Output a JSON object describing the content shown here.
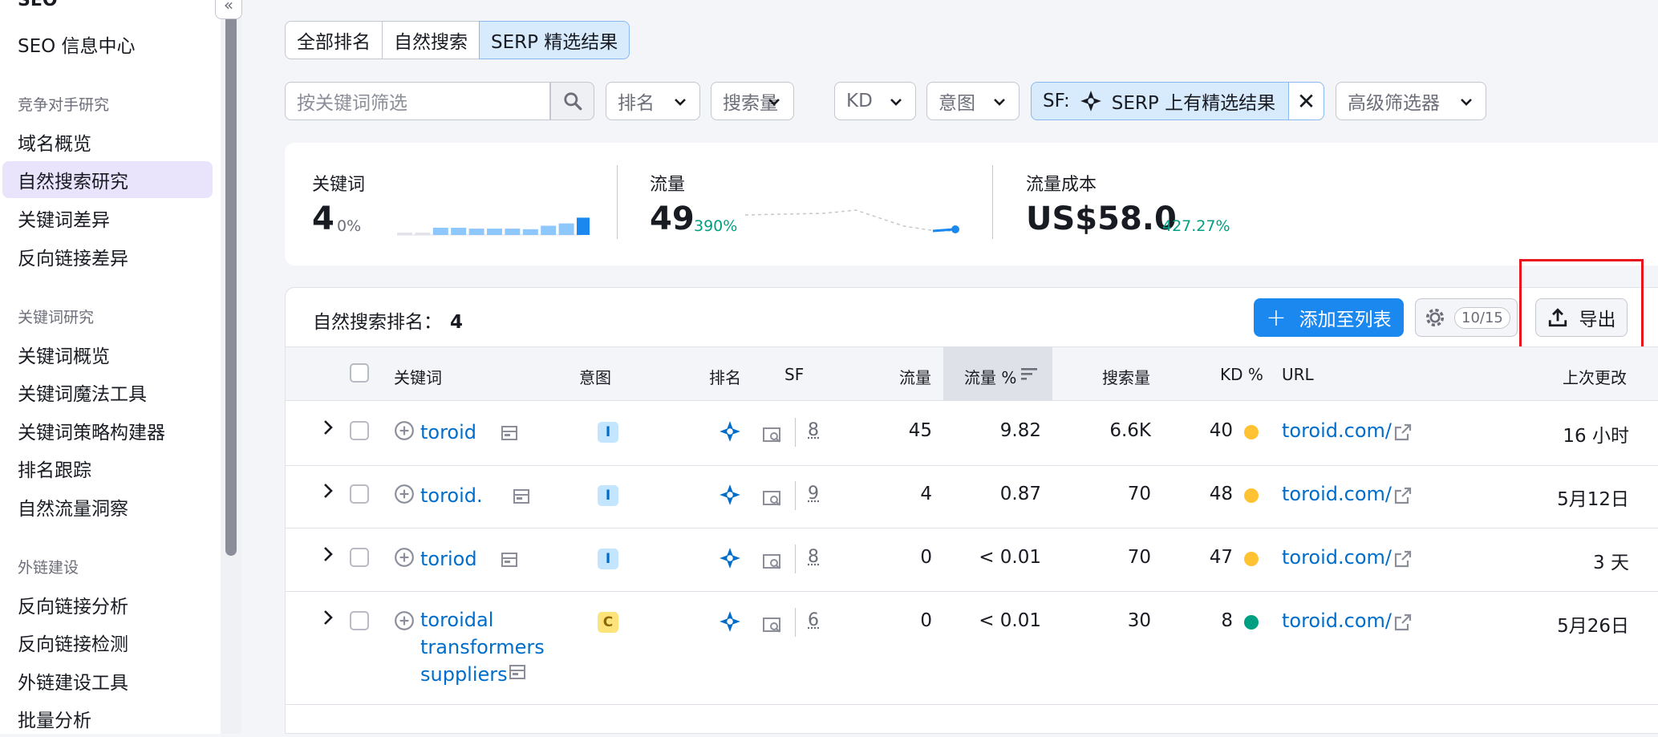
{
  "sidebar": {
    "top_label": "SEO",
    "items": [
      {
        "label": "SEO 信息中心"
      },
      {
        "label": "域名概览"
      },
      {
        "label": "自然搜索研究"
      },
      {
        "label": "关键词差异"
      },
      {
        "label": "反向链接差异"
      },
      {
        "label": "关键词概览"
      },
      {
        "label": "关键词魔法工具"
      },
      {
        "label": "关键词策略构建器"
      },
      {
        "label": "排名跟踪"
      },
      {
        "label": "自然流量洞察"
      },
      {
        "label": "反向链接分析"
      },
      {
        "label": "反向链接检测"
      },
      {
        "label": "外链建设工具"
      },
      {
        "label": "批量分析"
      }
    ],
    "sections": [
      "竞争对手研究",
      "关键词研究",
      "外链建设"
    ]
  },
  "tabs": [
    "全部排名",
    "自然搜索",
    "SERP 精选结果"
  ],
  "filters": {
    "search_placeholder": "按关键词筛选",
    "rank": "排名",
    "volume": "搜索量",
    "kd": "KD",
    "intent": "意图",
    "sf_prefix": "SF:",
    "sf_value": "SERP 上有精选结果",
    "advanced": "高级筛选器"
  },
  "summary": {
    "keywords": {
      "label": "关键词",
      "value": "4",
      "delta": "0%"
    },
    "traffic": {
      "label": "流量",
      "value": "49",
      "delta": "390%"
    },
    "traffic_cost": {
      "label": "流量成本",
      "value": "US$58.0",
      "delta": "427.27%"
    },
    "keyword_trend": [
      0.08,
      0.08,
      0.25,
      0.25,
      0.22,
      0.22,
      0.22,
      0.2,
      0.32,
      0.4,
      0.6,
      0.65
    ],
    "accent": "#1a88ef",
    "positive": "#009f81"
  },
  "table": {
    "count_label": "自然搜索排名：",
    "count": "4",
    "add_button": "添加至列表",
    "columns_badge": "10/15",
    "export_button": "导出",
    "headers": {
      "keyword": "关键词",
      "intent": "意图",
      "rank": "排名",
      "sf": "SF",
      "traffic": "流量",
      "traffic_pct": "流量 %",
      "volume": "搜索量",
      "kd": "KD %",
      "url": "URL",
      "last_update": "上次更改"
    },
    "rows": [
      {
        "keyword": "toroid",
        "intent": "I",
        "sf": "8",
        "traffic": "45",
        "traffic_pct": "9.82",
        "volume": "6.6K",
        "kd": "40",
        "kd_color": "#ffc233",
        "url": "toroid.com/",
        "last_update": "16 小时"
      },
      {
        "keyword": "toroid.",
        "intent": "I",
        "sf": "9",
        "traffic": "4",
        "traffic_pct": "0.87",
        "volume": "70",
        "kd": "48",
        "kd_color": "#ffc233",
        "url": "toroid.com/",
        "last_update": "5月12日"
      },
      {
        "keyword": "toriod",
        "intent": "I",
        "sf": "8",
        "traffic": "0",
        "traffic_pct": "< 0.01",
        "volume": "70",
        "kd": "47",
        "kd_color": "#ffc233",
        "url": "toroid.com/",
        "last_update": "3 天"
      },
      {
        "keyword_lines": [
          "toroidal",
          "transformers",
          "suppliers"
        ],
        "intent": "C",
        "sf": "6",
        "traffic": "0",
        "traffic_pct": "< 0.01",
        "volume": "30",
        "kd": "8",
        "kd_color": "#009f81",
        "url": "toroid.com/",
        "last_update": "5月26日"
      }
    ]
  }
}
